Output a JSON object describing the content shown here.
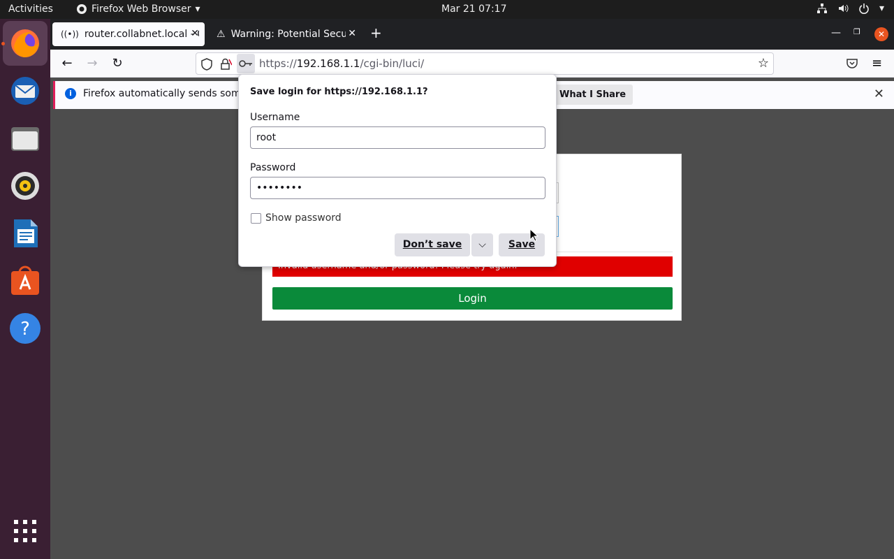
{
  "topbar": {
    "activities": "Activities",
    "app_name": "Firefox Web Browser",
    "clock": "Mar 21  07:17"
  },
  "dock": {
    "apps": [
      "firefox-icon",
      "thunderbird-icon",
      "files-icon",
      "rhythmbox-icon",
      "writer-icon",
      "software-icon",
      "help-icon",
      "app-grid-icon"
    ]
  },
  "tabs": [
    {
      "label": "router.collabnet.local - O"
    },
    {
      "label": "Warning: Potential Securi"
    }
  ],
  "urlbar": {
    "url_prefix": "https://",
    "url_host": "192.168.1.1",
    "url_path": "/cgi-bin/luci/"
  },
  "notification": {
    "text": "Firefox automatically sends some",
    "button": "What I Share"
  },
  "page": {
    "error": "Invalid username and/or password! Please try again.",
    "login_button": "Login"
  },
  "save_login": {
    "title": "Save login for https://192.168.1.1?",
    "username_label": "Username",
    "username_value": "root",
    "password_label": "Password",
    "password_value": "••••••••",
    "show_password": "Show password",
    "dont_save": "Don’t save",
    "save": "Save"
  },
  "colors": {
    "accent": "#e95420",
    "error": "#e00000",
    "login": "#0a8a3a"
  }
}
